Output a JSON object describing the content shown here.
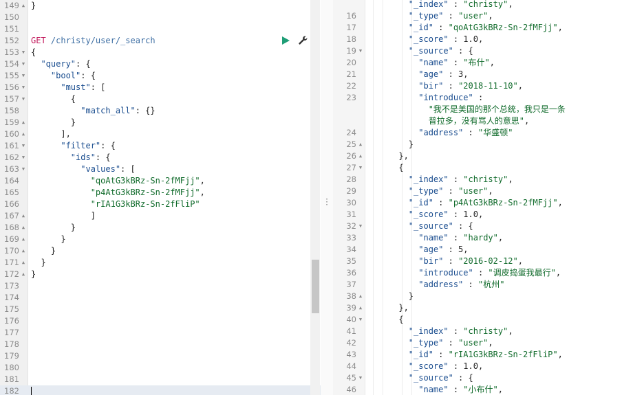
{
  "left_editor": {
    "request": {
      "method": "GET",
      "path": "/christy/user/_search"
    },
    "lines": [
      {
        "n": "149",
        "fold": "up",
        "parts": [
          [
            "p",
            "}"
          ]
        ]
      },
      {
        "n": "150",
        "parts": []
      },
      {
        "n": "151",
        "parts": []
      },
      {
        "n": "152",
        "parts": [
          [
            "m",
            "GET "
          ],
          [
            "u",
            "/christy/user/_search"
          ]
        ]
      },
      {
        "n": "153",
        "fold": "down",
        "parts": [
          [
            "p",
            "{"
          ]
        ]
      },
      {
        "n": "154",
        "fold": "down",
        "parts": [
          [
            "p",
            "  "
          ],
          [
            "k",
            "\"query\""
          ],
          [
            "p",
            ": {"
          ]
        ]
      },
      {
        "n": "155",
        "fold": "down",
        "parts": [
          [
            "p",
            "    "
          ],
          [
            "k",
            "\"bool\""
          ],
          [
            "p",
            ": {"
          ]
        ]
      },
      {
        "n": "156",
        "fold": "down",
        "parts": [
          [
            "p",
            "      "
          ],
          [
            "k",
            "\"must\""
          ],
          [
            "p",
            ": ["
          ]
        ]
      },
      {
        "n": "157",
        "fold": "down",
        "parts": [
          [
            "p",
            "        {"
          ]
        ]
      },
      {
        "n": "158",
        "parts": [
          [
            "p",
            "          "
          ],
          [
            "k",
            "\"match_all\""
          ],
          [
            "p",
            ": {}"
          ]
        ]
      },
      {
        "n": "159",
        "fold": "up",
        "parts": [
          [
            "p",
            "        }"
          ]
        ]
      },
      {
        "n": "160",
        "fold": "up",
        "parts": [
          [
            "p",
            "      ],"
          ]
        ]
      },
      {
        "n": "161",
        "fold": "down",
        "parts": [
          [
            "p",
            "      "
          ],
          [
            "k",
            "\"filter\""
          ],
          [
            "p",
            ": {"
          ]
        ]
      },
      {
        "n": "162",
        "fold": "down",
        "parts": [
          [
            "p",
            "        "
          ],
          [
            "k",
            "\"ids\""
          ],
          [
            "p",
            ": {"
          ]
        ]
      },
      {
        "n": "163",
        "fold": "down",
        "parts": [
          [
            "p",
            "          "
          ],
          [
            "k",
            "\"values\""
          ],
          [
            "p",
            ": ["
          ]
        ]
      },
      {
        "n": "164",
        "parts": [
          [
            "p",
            "            "
          ],
          [
            "s",
            "\"qoAtG3kBRz-Sn-2fMFjj\""
          ],
          [
            "p",
            ","
          ]
        ]
      },
      {
        "n": "165",
        "parts": [
          [
            "p",
            "            "
          ],
          [
            "s",
            "\"p4AtG3kBRz-Sn-2fMFjj\""
          ],
          [
            "p",
            ","
          ]
        ]
      },
      {
        "n": "166",
        "parts": [
          [
            "p",
            "            "
          ],
          [
            "s",
            "\"rIA1G3kBRz-Sn-2fFliP\""
          ]
        ]
      },
      {
        "n": "167",
        "fold": "up",
        "parts": [
          [
            "p",
            "            ]"
          ]
        ]
      },
      {
        "n": "168",
        "fold": "up",
        "parts": [
          [
            "p",
            "        }"
          ]
        ]
      },
      {
        "n": "169",
        "fold": "up",
        "parts": [
          [
            "p",
            "      }"
          ]
        ]
      },
      {
        "n": "170",
        "fold": "up",
        "parts": [
          [
            "p",
            "    }"
          ]
        ]
      },
      {
        "n": "171",
        "fold": "up",
        "parts": [
          [
            "p",
            "  }"
          ]
        ]
      },
      {
        "n": "172",
        "fold": "up",
        "parts": [
          [
            "p",
            "}"
          ]
        ]
      },
      {
        "n": "173",
        "parts": []
      },
      {
        "n": "174",
        "parts": []
      },
      {
        "n": "175",
        "parts": []
      },
      {
        "n": "176",
        "parts": []
      },
      {
        "n": "177",
        "parts": []
      },
      {
        "n": "178",
        "parts": []
      },
      {
        "n": "179",
        "parts": []
      },
      {
        "n": "180",
        "parts": []
      },
      {
        "n": "181",
        "parts": []
      },
      {
        "n": "182",
        "parts": [],
        "current": true
      }
    ]
  },
  "right_editor": {
    "lines": [
      {
        "n": "",
        "parts": [
          [
            "p",
            "        "
          ],
          [
            "k",
            "\"_index\""
          ],
          [
            "p",
            " : "
          ],
          [
            "s",
            "\"christy\""
          ],
          [
            "p",
            ","
          ]
        ]
      },
      {
        "n": "16",
        "parts": [
          [
            "p",
            "        "
          ],
          [
            "k",
            "\"_type\""
          ],
          [
            "p",
            " : "
          ],
          [
            "s",
            "\"user\""
          ],
          [
            "p",
            ","
          ]
        ]
      },
      {
        "n": "17",
        "parts": [
          [
            "p",
            "        "
          ],
          [
            "k",
            "\"_id\""
          ],
          [
            "p",
            " : "
          ],
          [
            "s",
            "\"qoAtG3kBRz-Sn-2fMFjj\""
          ],
          [
            "p",
            ","
          ]
        ]
      },
      {
        "n": "18",
        "parts": [
          [
            "p",
            "        "
          ],
          [
            "k",
            "\"_score\""
          ],
          [
            "p",
            " : 1.0,"
          ]
        ]
      },
      {
        "n": "19",
        "fold": "down",
        "parts": [
          [
            "p",
            "        "
          ],
          [
            "k",
            "\"_source\""
          ],
          [
            "p",
            " : {"
          ]
        ]
      },
      {
        "n": "20",
        "parts": [
          [
            "p",
            "          "
          ],
          [
            "k",
            "\"name\""
          ],
          [
            "p",
            " : "
          ],
          [
            "s",
            "\"布什\""
          ],
          [
            "p",
            ","
          ]
        ]
      },
      {
        "n": "21",
        "parts": [
          [
            "p",
            "          "
          ],
          [
            "k",
            "\"age\""
          ],
          [
            "p",
            " : 3,"
          ]
        ]
      },
      {
        "n": "22",
        "parts": [
          [
            "p",
            "          "
          ],
          [
            "k",
            "\"bir\""
          ],
          [
            "p",
            " : "
          ],
          [
            "s",
            "\"2018-11-10\""
          ],
          [
            "p",
            ","
          ]
        ]
      },
      {
        "n": "23",
        "parts": [
          [
            "p",
            "          "
          ],
          [
            "k",
            "\"introduce\""
          ],
          [
            "p",
            " :"
          ]
        ]
      },
      {
        "n": "",
        "parts": [
          [
            "p",
            "            "
          ],
          [
            "s",
            "\"我不是美国的那个总统，我只是一条"
          ]
        ]
      },
      {
        "n": "",
        "parts": [
          [
            "p",
            "            "
          ],
          [
            "s",
            "普拉多，没有骂人的意思\""
          ],
          [
            "p",
            ","
          ]
        ]
      },
      {
        "n": "24",
        "parts": [
          [
            "p",
            "          "
          ],
          [
            "k",
            "\"address\""
          ],
          [
            "p",
            " : "
          ],
          [
            "s",
            "\"华盛顿\""
          ]
        ]
      },
      {
        "n": "25",
        "fold": "up",
        "parts": [
          [
            "p",
            "        }"
          ]
        ]
      },
      {
        "n": "26",
        "fold": "up",
        "parts": [
          [
            "p",
            "      },"
          ]
        ]
      },
      {
        "n": "27",
        "fold": "down",
        "parts": [
          [
            "p",
            "      {"
          ]
        ]
      },
      {
        "n": "28",
        "parts": [
          [
            "p",
            "        "
          ],
          [
            "k",
            "\"_index\""
          ],
          [
            "p",
            " : "
          ],
          [
            "s",
            "\"christy\""
          ],
          [
            "p",
            ","
          ]
        ]
      },
      {
        "n": "29",
        "parts": [
          [
            "p",
            "        "
          ],
          [
            "k",
            "\"_type\""
          ],
          [
            "p",
            " : "
          ],
          [
            "s",
            "\"user\""
          ],
          [
            "p",
            ","
          ]
        ]
      },
      {
        "n": "30",
        "parts": [
          [
            "p",
            "        "
          ],
          [
            "k",
            "\"_id\""
          ],
          [
            "p",
            " : "
          ],
          [
            "s",
            "\"p4AtG3kBRz-Sn-2fMFjj\""
          ],
          [
            "p",
            ","
          ]
        ]
      },
      {
        "n": "31",
        "parts": [
          [
            "p",
            "        "
          ],
          [
            "k",
            "\"_score\""
          ],
          [
            "p",
            " : 1.0,"
          ]
        ]
      },
      {
        "n": "32",
        "fold": "down",
        "parts": [
          [
            "p",
            "        "
          ],
          [
            "k",
            "\"_source\""
          ],
          [
            "p",
            " : {"
          ]
        ]
      },
      {
        "n": "33",
        "parts": [
          [
            "p",
            "          "
          ],
          [
            "k",
            "\"name\""
          ],
          [
            "p",
            " : "
          ],
          [
            "s",
            "\"hardy\""
          ],
          [
            "p",
            ","
          ]
        ]
      },
      {
        "n": "34",
        "parts": [
          [
            "p",
            "          "
          ],
          [
            "k",
            "\"age\""
          ],
          [
            "p",
            " : 5,"
          ]
        ]
      },
      {
        "n": "35",
        "parts": [
          [
            "p",
            "          "
          ],
          [
            "k",
            "\"bir\""
          ],
          [
            "p",
            " : "
          ],
          [
            "s",
            "\"2016-02-12\""
          ],
          [
            "p",
            ","
          ]
        ]
      },
      {
        "n": "36",
        "parts": [
          [
            "p",
            "          "
          ],
          [
            "k",
            "\"introduce\""
          ],
          [
            "p",
            " : "
          ],
          [
            "s",
            "\"调皮捣蛋我最行\""
          ],
          [
            "p",
            ","
          ]
        ]
      },
      {
        "n": "37",
        "parts": [
          [
            "p",
            "          "
          ],
          [
            "k",
            "\"address\""
          ],
          [
            "p",
            " : "
          ],
          [
            "s",
            "\"杭州\""
          ]
        ]
      },
      {
        "n": "38",
        "fold": "up",
        "parts": [
          [
            "p",
            "        }"
          ]
        ]
      },
      {
        "n": "39",
        "fold": "up",
        "parts": [
          [
            "p",
            "      },"
          ]
        ]
      },
      {
        "n": "40",
        "fold": "down",
        "parts": [
          [
            "p",
            "      {"
          ]
        ]
      },
      {
        "n": "41",
        "parts": [
          [
            "p",
            "        "
          ],
          [
            "k",
            "\"_index\""
          ],
          [
            "p",
            " : "
          ],
          [
            "s",
            "\"christy\""
          ],
          [
            "p",
            ","
          ]
        ]
      },
      {
        "n": "42",
        "parts": [
          [
            "p",
            "        "
          ],
          [
            "k",
            "\"_type\""
          ],
          [
            "p",
            " : "
          ],
          [
            "s",
            "\"user\""
          ],
          [
            "p",
            ","
          ]
        ]
      },
      {
        "n": "43",
        "parts": [
          [
            "p",
            "        "
          ],
          [
            "k",
            "\"_id\""
          ],
          [
            "p",
            " : "
          ],
          [
            "s",
            "\"rIA1G3kBRz-Sn-2fFliP\""
          ],
          [
            "p",
            ","
          ]
        ]
      },
      {
        "n": "44",
        "parts": [
          [
            "p",
            "        "
          ],
          [
            "k",
            "\"_score\""
          ],
          [
            "p",
            " : 1.0,"
          ]
        ]
      },
      {
        "n": "45",
        "fold": "down",
        "parts": [
          [
            "p",
            "        "
          ],
          [
            "k",
            "\"_source\""
          ],
          [
            "p",
            " : {"
          ]
        ]
      },
      {
        "n": "46",
        "parts": [
          [
            "p",
            "          "
          ],
          [
            "k",
            "\"name\""
          ],
          [
            "p",
            " : "
          ],
          [
            "s",
            "\"小布什\""
          ],
          [
            "p",
            ","
          ]
        ]
      }
    ]
  },
  "icons": {
    "play": "play-icon",
    "wrench": "wrench-icon",
    "fold_down": "fold-down-icon",
    "fold_up": "fold-up-icon",
    "splitter": "splitter-grip-icon"
  },
  "colors": {
    "method": "#c2185b",
    "url": "#3d6ea3",
    "key": "#1a4d8f",
    "string": "#0f6a2a",
    "run": "#1f9e77"
  }
}
